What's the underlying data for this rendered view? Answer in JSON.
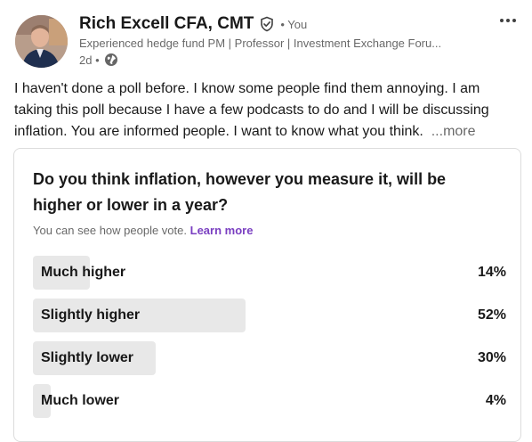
{
  "author": {
    "name": "Rich Excell CFA, CMT",
    "connection": "• You",
    "headline": "Experienced hedge fund PM | Professor | Investment Exchange Foru...",
    "time": "2d •",
    "verified_icon": "shield-check-icon",
    "visibility_icon": "globe-icon",
    "avatar_icon": "profile-photo"
  },
  "menu": {
    "icon": "three-dots-icon"
  },
  "post": {
    "text": "I haven't done a poll before. I know some people find them annoying. I am taking this poll because I have a few podcasts to do and I will be discussing inflation. You are informed people. I want to know what you think.",
    "see_more": "...more"
  },
  "poll": {
    "question": "Do you think inflation, however you measure it, will be higher or lower in a year?",
    "note": "You can see how people vote.",
    "learn_more": "Learn more",
    "options": [
      {
        "label": "Much higher",
        "percent_text": "14%",
        "percent": 14
      },
      {
        "label": "Slightly higher",
        "percent_text": "52%",
        "percent": 52
      },
      {
        "label": "Slightly lower",
        "percent_text": "30%",
        "percent": 30
      },
      {
        "label": "Much lower",
        "percent_text": "4%",
        "percent": 4
      }
    ],
    "bar_color": "#e8e8e8",
    "link_color": "#7a3fc1"
  }
}
